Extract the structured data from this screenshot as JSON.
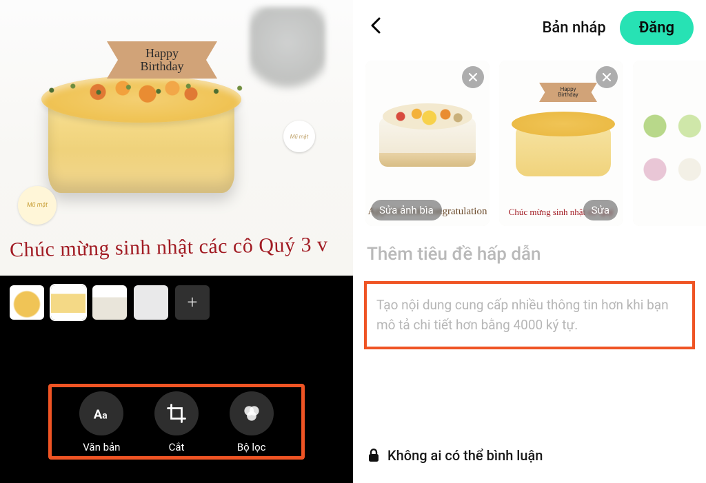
{
  "left": {
    "cake_sign": "Happy\nBirthday",
    "brand_small": "Mũ mật",
    "box_brand": "Mũ mật",
    "handwriting": "Chúc mừng sinh nhật các cô Quý 3 v",
    "add_label": "+",
    "tools": {
      "text": "Văn bản",
      "crop": "Cắt",
      "filter": "Bộ lọc"
    }
  },
  "right": {
    "draft": "Bản nháp",
    "publish": "Đăng",
    "gallery": {
      "cover_badge": "Sửa ảnh bìa",
      "edit_badge": "Sửa",
      "card1_text": "Appointment Congratulation",
      "card2_sign": "Happy\nBirthday",
      "card2_text": "Chúc mừng sinh nhật cô Quý"
    },
    "title_placeholder": "Thêm tiêu đề hấp dẫn",
    "desc_placeholder": "Tạo nội dung cung cấp nhiều thông tin hơn khi bạn mô tả chi tiết hơn bằng 4000 ký tự.",
    "comment_lock": "Không ai có thể bình luận"
  },
  "colors": {
    "accent": "#27e2b4",
    "highlight": "#ef5424"
  }
}
